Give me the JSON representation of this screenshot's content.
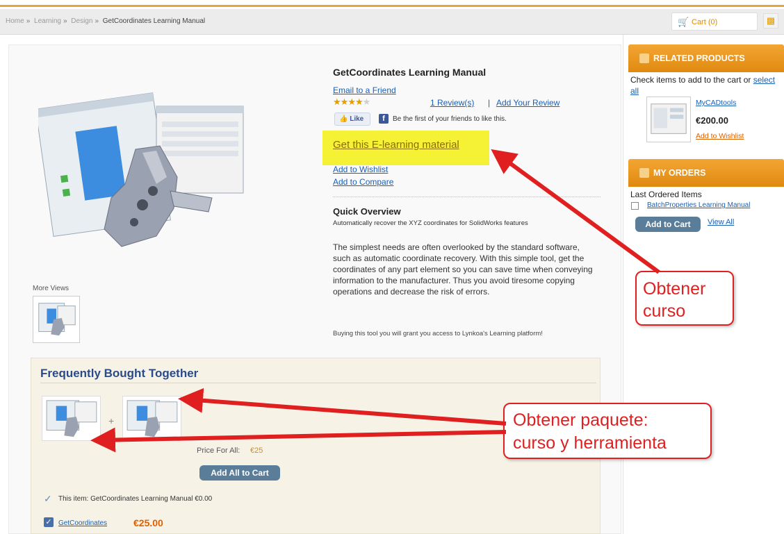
{
  "breadcrumb": {
    "items": [
      "Home",
      "Learning",
      "Design"
    ],
    "separator": "»",
    "current": "GetCoordinates Learning Manual"
  },
  "cart": {
    "label": "Cart (0)",
    "icon": "cart-icon"
  },
  "product": {
    "title": "GetCoordinates Learning Manual",
    "email_link": "Email to a Friend",
    "rating_stars": 4,
    "rating_max": 5,
    "reviews_link": "1 Review(s)",
    "review_separator": "|",
    "add_review_link": "Add Your Review",
    "fb_like": "Like",
    "fb_icon_letter": "f",
    "fb_text": "Be the first of your friends to like this.",
    "get_link": "Get this E-learning material",
    "wishlist_link": "Add to Wishlist",
    "compare_link": "Add to Compare",
    "more_views_label": "More Views"
  },
  "quick_overview": {
    "title": "Quick Overview",
    "subtitle": "Automatically recover the XYZ coordinates for SolidWorks features",
    "description": "The simplest needs are often overlooked by the standard software, such as automatic coordinate recovery. With this simple tool, get the coordinates of any part element so you can save time when conveying information to the manufacturer. Thus you avoid tiresome copying operations and decrease the risk of errors.",
    "buying_note": "Buying this tool you will grant you access to Lynkoa's Learning platform!"
  },
  "fbt": {
    "title": "Frequently Bought Together",
    "plus": "+",
    "price_all_label": "Price For All:",
    "price_all_value": "€25",
    "add_all_button": "Add All to Cart",
    "item1_text": "This item: GetCoordinates Learning Manual €0.00",
    "item2_link": "GetCoordinates",
    "item2_price": "€25.00"
  },
  "related_products": {
    "header": "RELATED PRODUCTS",
    "check_text": "Check items to add to the cart or ",
    "select_all": "select all",
    "item_name": "MyCADtools",
    "item_price": "€200.00",
    "item_wishlist": "Add to Wishlist"
  },
  "my_orders": {
    "header": "MY ORDERS",
    "last_ordered": "Last Ordered Items",
    "item": "BatchProperties Learning Manual",
    "add_button": "Add to Cart",
    "view_all": "View All"
  },
  "annotations": {
    "callout1_line1": "Obtener",
    "callout1_line2": "curso",
    "callout2_line1": "Obtener paquete:",
    "callout2_line2": "curso y herramienta"
  },
  "colors": {
    "accent_orange": "#e08910",
    "highlight_yellow": "#f5f135",
    "annotation_red": "#e02020",
    "link_blue": "#1a5fb4",
    "button_slate": "#5a7d9a"
  }
}
